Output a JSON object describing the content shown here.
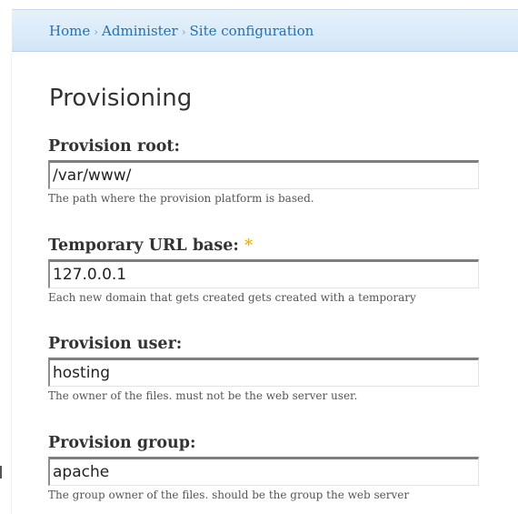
{
  "breadcrumb": {
    "items": [
      "Home",
      "Administer",
      "Site configuration"
    ],
    "separator": "›"
  },
  "page": {
    "title": "Provisioning"
  },
  "fields": [
    {
      "label": "Provision root:",
      "value": "/var/www/",
      "description": "The path where the provision platform is based.",
      "required": false
    },
    {
      "label": "Temporary URL base:",
      "value": "127.0.0.1",
      "description": "Each new domain that gets created gets created with a temporary",
      "required": true,
      "required_mark": "*"
    },
    {
      "label": "Provision user:",
      "value": "hosting",
      "description": "The owner of the files. must not be the web server user.",
      "required": false
    },
    {
      "label": "Provision group:",
      "value": "apache",
      "description": "The group owner of the files. should be the group the web server",
      "required": false
    }
  ],
  "colors": {
    "link": "#2b6fa8",
    "required": "#f4b400",
    "header_bg": "#d2e6f7"
  }
}
